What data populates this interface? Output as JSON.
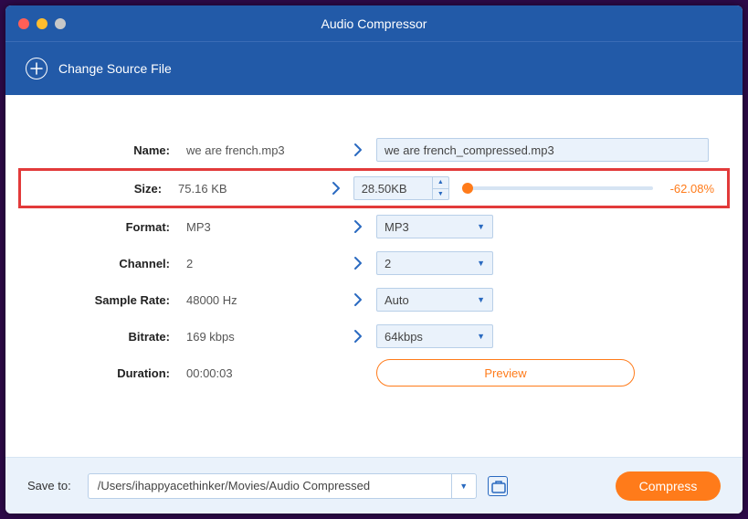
{
  "window": {
    "title": "Audio Compressor"
  },
  "subheader": {
    "change_source": "Change Source File"
  },
  "rows": {
    "name": {
      "label": "Name:",
      "src": "we are french.mp3",
      "out": "we are french_compressed.mp3"
    },
    "size": {
      "label": "Size:",
      "src": "75.16 KB",
      "out": "28.50KB",
      "pct": "-62.08%"
    },
    "format": {
      "label": "Format:",
      "src": "MP3",
      "out": "MP3"
    },
    "channel": {
      "label": "Channel:",
      "src": "2",
      "out": "2"
    },
    "sample": {
      "label": "Sample Rate:",
      "src": "48000 Hz",
      "out": "Auto"
    },
    "bitrate": {
      "label": "Bitrate:",
      "src": "169 kbps",
      "out": "64kbps"
    },
    "duration": {
      "label": "Duration:",
      "src": "00:00:03"
    }
  },
  "buttons": {
    "preview": "Preview",
    "compress": "Compress"
  },
  "footer": {
    "save_to_label": "Save to:",
    "path": "/Users/ihappyacethinker/Movies/Audio Compressed"
  }
}
